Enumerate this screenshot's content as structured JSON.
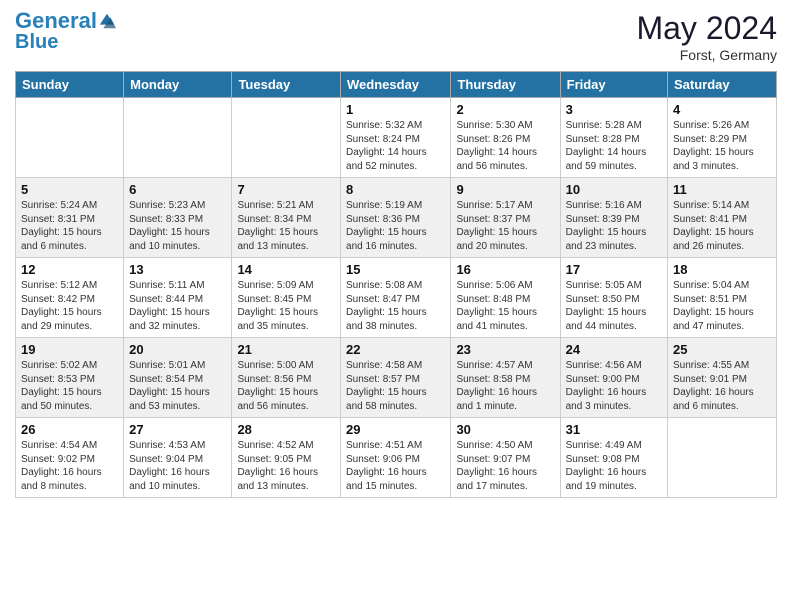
{
  "logo": {
    "line1": "General",
    "line2": "Blue"
  },
  "title": "May 2024",
  "location": "Forst, Germany",
  "weekdays": [
    "Sunday",
    "Monday",
    "Tuesday",
    "Wednesday",
    "Thursday",
    "Friday",
    "Saturday"
  ],
  "weeks": [
    [
      {
        "day": "",
        "info": ""
      },
      {
        "day": "",
        "info": ""
      },
      {
        "day": "",
        "info": ""
      },
      {
        "day": "1",
        "info": "Sunrise: 5:32 AM\nSunset: 8:24 PM\nDaylight: 14 hours\nand 52 minutes."
      },
      {
        "day": "2",
        "info": "Sunrise: 5:30 AM\nSunset: 8:26 PM\nDaylight: 14 hours\nand 56 minutes."
      },
      {
        "day": "3",
        "info": "Sunrise: 5:28 AM\nSunset: 8:28 PM\nDaylight: 14 hours\nand 59 minutes."
      },
      {
        "day": "4",
        "info": "Sunrise: 5:26 AM\nSunset: 8:29 PM\nDaylight: 15 hours\nand 3 minutes."
      }
    ],
    [
      {
        "day": "5",
        "info": "Sunrise: 5:24 AM\nSunset: 8:31 PM\nDaylight: 15 hours\nand 6 minutes."
      },
      {
        "day": "6",
        "info": "Sunrise: 5:23 AM\nSunset: 8:33 PM\nDaylight: 15 hours\nand 10 minutes."
      },
      {
        "day": "7",
        "info": "Sunrise: 5:21 AM\nSunset: 8:34 PM\nDaylight: 15 hours\nand 13 minutes."
      },
      {
        "day": "8",
        "info": "Sunrise: 5:19 AM\nSunset: 8:36 PM\nDaylight: 15 hours\nand 16 minutes."
      },
      {
        "day": "9",
        "info": "Sunrise: 5:17 AM\nSunset: 8:37 PM\nDaylight: 15 hours\nand 20 minutes."
      },
      {
        "day": "10",
        "info": "Sunrise: 5:16 AM\nSunset: 8:39 PM\nDaylight: 15 hours\nand 23 minutes."
      },
      {
        "day": "11",
        "info": "Sunrise: 5:14 AM\nSunset: 8:41 PM\nDaylight: 15 hours\nand 26 minutes."
      }
    ],
    [
      {
        "day": "12",
        "info": "Sunrise: 5:12 AM\nSunset: 8:42 PM\nDaylight: 15 hours\nand 29 minutes."
      },
      {
        "day": "13",
        "info": "Sunrise: 5:11 AM\nSunset: 8:44 PM\nDaylight: 15 hours\nand 32 minutes."
      },
      {
        "day": "14",
        "info": "Sunrise: 5:09 AM\nSunset: 8:45 PM\nDaylight: 15 hours\nand 35 minutes."
      },
      {
        "day": "15",
        "info": "Sunrise: 5:08 AM\nSunset: 8:47 PM\nDaylight: 15 hours\nand 38 minutes."
      },
      {
        "day": "16",
        "info": "Sunrise: 5:06 AM\nSunset: 8:48 PM\nDaylight: 15 hours\nand 41 minutes."
      },
      {
        "day": "17",
        "info": "Sunrise: 5:05 AM\nSunset: 8:50 PM\nDaylight: 15 hours\nand 44 minutes."
      },
      {
        "day": "18",
        "info": "Sunrise: 5:04 AM\nSunset: 8:51 PM\nDaylight: 15 hours\nand 47 minutes."
      }
    ],
    [
      {
        "day": "19",
        "info": "Sunrise: 5:02 AM\nSunset: 8:53 PM\nDaylight: 15 hours\nand 50 minutes."
      },
      {
        "day": "20",
        "info": "Sunrise: 5:01 AM\nSunset: 8:54 PM\nDaylight: 15 hours\nand 53 minutes."
      },
      {
        "day": "21",
        "info": "Sunrise: 5:00 AM\nSunset: 8:56 PM\nDaylight: 15 hours\nand 56 minutes."
      },
      {
        "day": "22",
        "info": "Sunrise: 4:58 AM\nSunset: 8:57 PM\nDaylight: 15 hours\nand 58 minutes."
      },
      {
        "day": "23",
        "info": "Sunrise: 4:57 AM\nSunset: 8:58 PM\nDaylight: 16 hours\nand 1 minute."
      },
      {
        "day": "24",
        "info": "Sunrise: 4:56 AM\nSunset: 9:00 PM\nDaylight: 16 hours\nand 3 minutes."
      },
      {
        "day": "25",
        "info": "Sunrise: 4:55 AM\nSunset: 9:01 PM\nDaylight: 16 hours\nand 6 minutes."
      }
    ],
    [
      {
        "day": "26",
        "info": "Sunrise: 4:54 AM\nSunset: 9:02 PM\nDaylight: 16 hours\nand 8 minutes."
      },
      {
        "day": "27",
        "info": "Sunrise: 4:53 AM\nSunset: 9:04 PM\nDaylight: 16 hours\nand 10 minutes."
      },
      {
        "day": "28",
        "info": "Sunrise: 4:52 AM\nSunset: 9:05 PM\nDaylight: 16 hours\nand 13 minutes."
      },
      {
        "day": "29",
        "info": "Sunrise: 4:51 AM\nSunset: 9:06 PM\nDaylight: 16 hours\nand 15 minutes."
      },
      {
        "day": "30",
        "info": "Sunrise: 4:50 AM\nSunset: 9:07 PM\nDaylight: 16 hours\nand 17 minutes."
      },
      {
        "day": "31",
        "info": "Sunrise: 4:49 AM\nSunset: 9:08 PM\nDaylight: 16 hours\nand 19 minutes."
      },
      {
        "day": "",
        "info": ""
      }
    ]
  ]
}
